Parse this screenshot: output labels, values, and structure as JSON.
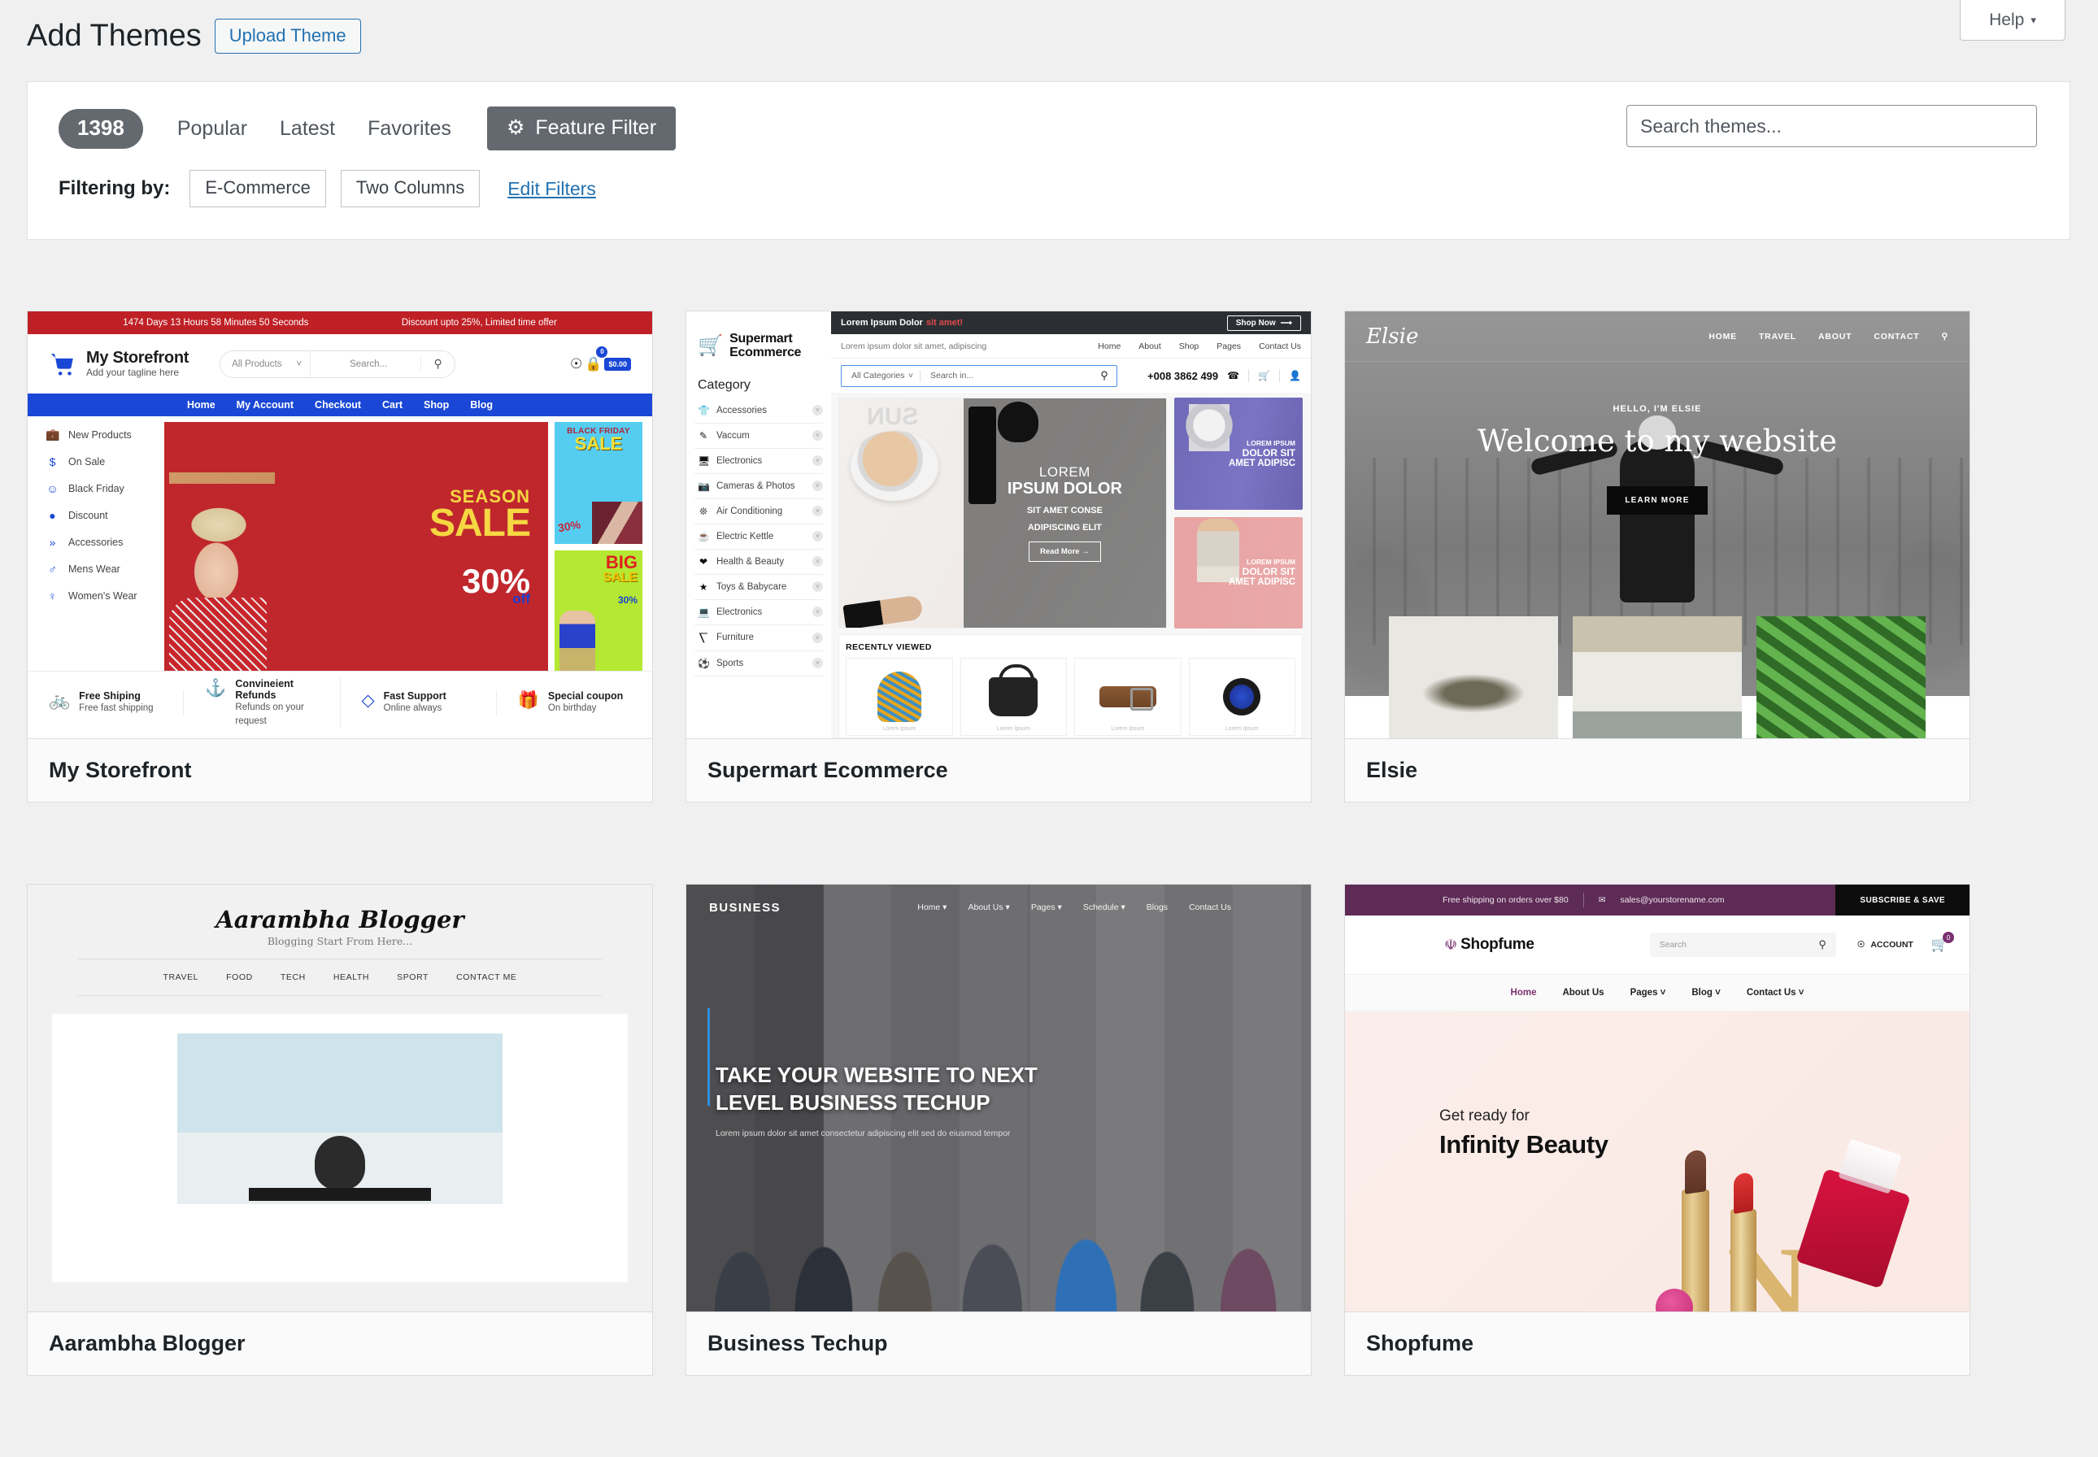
{
  "topbar": {
    "help_label": "Help",
    "help_caret": "▾"
  },
  "header": {
    "page_title": "Add Themes",
    "upload_theme_label": "Upload Theme"
  },
  "filter_panel": {
    "count": "1398",
    "tabs": [
      {
        "label": "Popular"
      },
      {
        "label": "Latest"
      },
      {
        "label": "Favorites"
      }
    ],
    "feature_filter_label": "Feature Filter",
    "feature_filter_icon": "gear-icon",
    "search_placeholder": "Search themes...",
    "filtering_label": "Filtering by:",
    "chips": [
      "E-Commerce",
      "Two Columns"
    ],
    "edit_filters_label": "Edit Filters"
  },
  "themes": [
    {
      "name": "My Storefront",
      "preview": {
        "countdown": "1474 Days 13 Hours 58 Minutes 50 Seconds",
        "offer": "Discount upto 25%, Limited time offer",
        "brand": "My Storefront",
        "tagline": "Add your tagline here",
        "search_category": "All Products",
        "search_placeholder": "Search...",
        "cart_total": "$0.00",
        "cart_count": "0",
        "nav": [
          "Home",
          "My Account",
          "Checkout",
          "Cart",
          "Shop",
          "Blog"
        ],
        "sidebar": [
          {
            "label": "New Products",
            "icon": "briefcase-icon"
          },
          {
            "label": "On Sale",
            "icon": "dollar-icon"
          },
          {
            "label": "Black Friday",
            "icon": "smiley-icon"
          },
          {
            "label": "Discount",
            "icon": "chat-icon"
          },
          {
            "label": "Accessories",
            "icon": "double-chevron-icon"
          },
          {
            "label": "Mens Wear",
            "icon": "man-icon"
          },
          {
            "label": "Women's Wear",
            "icon": "woman-icon"
          }
        ],
        "banner_main": {
          "line1": "SEASON",
          "line2": "SALE",
          "pct": "30%",
          "off": "off"
        },
        "banner_bf": {
          "line1": "BLACK FRIDAY",
          "line2": "SALE",
          "pct": "30%"
        },
        "banner_big": {
          "line1": "BIG",
          "line2": "SALE",
          "pct": "30%"
        },
        "features": [
          {
            "title": "Free Shiping",
            "sub": "Free fast shipping",
            "icon": "bicycle-icon"
          },
          {
            "title": "Convineient Refunds",
            "sub": "Refunds on your request",
            "icon": "anchor-icon"
          },
          {
            "title": "Fast Support",
            "sub": "Online always",
            "icon": "diamond-icon"
          },
          {
            "title": "Special coupon",
            "sub": "On birthday",
            "icon": "gift-icon"
          }
        ]
      }
    },
    {
      "name": "Supermart Ecommerce",
      "preview": {
        "brand_line1": "Supermart",
        "brand_line2": "Ecommerce",
        "topbar_text": "Lorem Ipsum Dolor",
        "topbar_accent": "sit amet!",
        "shop_now": "Shop Now",
        "subbar_text": "Lorem ipsum dolor sit amet, adipiscing",
        "subnav": [
          "Home",
          "About",
          "Shop",
          "Pages",
          "Contact Us"
        ],
        "search_category": "All Categories",
        "search_placeholder": "Search in...",
        "phone": "+008 3862 499",
        "category_heading": "Category",
        "categories": [
          {
            "label": "Accessories",
            "icon": "tshirt-icon"
          },
          {
            "label": "Vaccum",
            "icon": "brush-icon"
          },
          {
            "label": "Electronics",
            "icon": "monitor-icon"
          },
          {
            "label": "Cameras & Photos",
            "icon": "camera-icon"
          },
          {
            "label": "Air Conditioning",
            "icon": "fan-icon"
          },
          {
            "label": "Electric Kettle",
            "icon": "kettle-icon"
          },
          {
            "label": "Health & Beauty",
            "icon": "heart-icon"
          },
          {
            "label": "Toys & Babycare",
            "icon": "toy-icon"
          },
          {
            "label": "Electronics",
            "icon": "laptop-icon"
          },
          {
            "label": "Furniture",
            "icon": "chair-icon"
          },
          {
            "label": "Sports",
            "icon": "ball-icon"
          }
        ],
        "hero": {
          "line1": "LOREM",
          "line2": "IPSUM DOLOR",
          "line3a": "SIT AMET CONSE",
          "line3b": "ADIPISCING ELIT",
          "button": "Read More →"
        },
        "promo_purple": {
          "l1": "LOREM IPSUM",
          "l2": "DOLOR SIT",
          "l3": "AMET ADIPISC"
        },
        "promo_pink": {
          "l1": "LOREM IPSUM",
          "l2": "DOLOR SIT",
          "l3": "AMET ADIPISC"
        },
        "recent_heading": "RECENTLY VIEWED",
        "products": [
          {
            "name": "Lorem Ipsum",
            "kind": "beanie"
          },
          {
            "name": "Lorem Ipsum",
            "kind": "handbag"
          },
          {
            "name": "Lorem Ipsum",
            "kind": "belt"
          },
          {
            "name": "Lorem Ipsum",
            "kind": "watch"
          }
        ]
      }
    },
    {
      "name": "Elsie",
      "preview": {
        "logo": "Elsie",
        "nav": [
          "HOME",
          "TRAVEL",
          "ABOUT",
          "CONTACT"
        ],
        "search_icon": "search-icon",
        "eyebrow": "HELLO, I'M ELSIE",
        "headline": "Welcome to my website",
        "cta": "LEARN MORE"
      }
    },
    {
      "name": "Aarambha Blogger",
      "preview": {
        "logo": "Aarambha Blogger",
        "tagline": "Blogging Start From Here...",
        "nav": [
          "TRAVEL",
          "FOOD",
          "TECH",
          "HEALTH",
          "SPORT",
          "CONTACT ME"
        ]
      }
    },
    {
      "name": "Business Techup",
      "preview": {
        "brand": "BUSINESS",
        "nav": [
          "Home ▾",
          "About Us ▾",
          "Pages ▾",
          "Schedule ▾",
          "Blogs",
          "Contact Us"
        ],
        "headline_l1": "TAKE YOUR WEBSITE TO NEXT",
        "headline_l2": "LEVEL BUSINESS TECHUP",
        "sub": "Lorem ipsum dolor sit amet consectetur adipiscing elit sed do eiusmod tempor"
      }
    },
    {
      "name": "Shopfume",
      "preview": {
        "shipping_note": "Free shipping on orders over $80",
        "email": "sales@yourstorename.com",
        "subscribe": "SUBSCRIBE & SAVE",
        "brand": "Shopfume",
        "search_placeholder": "Search",
        "account": "ACCOUNT",
        "cart_count": "0",
        "nav": [
          "Home",
          "About Us",
          "Pages ˅",
          "Blog ˅",
          "Contact Us ˅"
        ],
        "hero_eyebrow": "Get ready for",
        "hero_title": "Infinity Beauty"
      }
    }
  ]
}
